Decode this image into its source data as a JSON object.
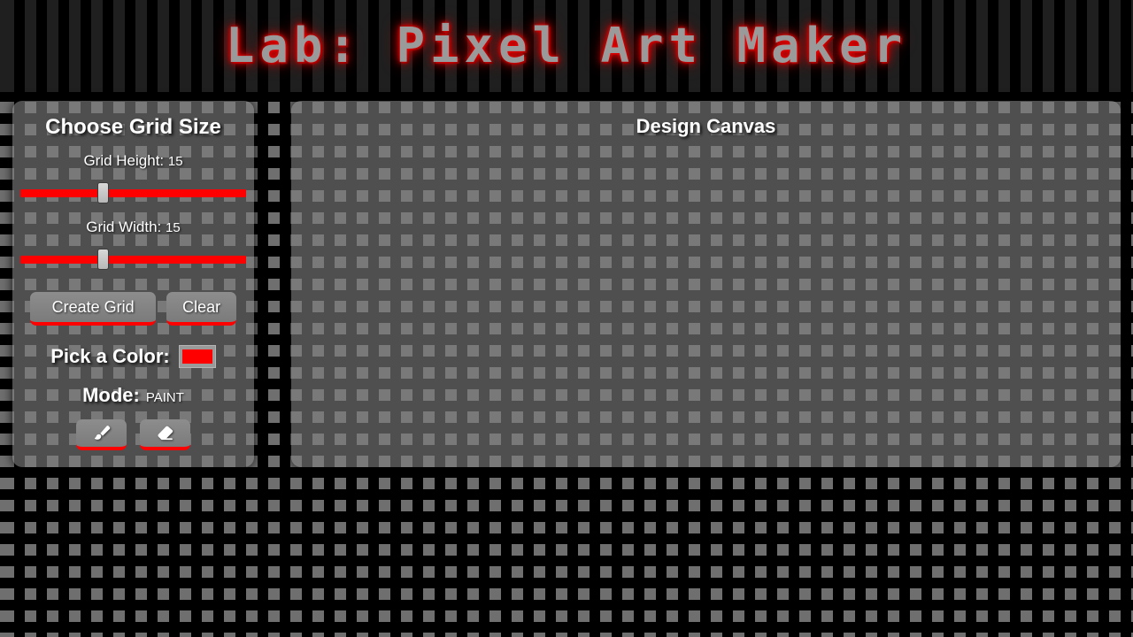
{
  "header": {
    "title": "Lab: Pixel Art Maker"
  },
  "sidebar": {
    "title": "Choose Grid Size",
    "height_slider": {
      "label": "Grid Height:",
      "value": "15",
      "min": 1,
      "max": 40,
      "current": 15
    },
    "width_slider": {
      "label": "Grid Width:",
      "value": "15",
      "min": 1,
      "max": 40,
      "current": 15
    },
    "create_grid_label": "Create Grid",
    "clear_label": "Clear",
    "color_label": "Pick a Color:",
    "color_value": "#ff0000",
    "mode_label": "Mode:",
    "mode_value": "PAINT",
    "tools": [
      {
        "name": "brush-tool",
        "icon": "paintbrush-icon"
      },
      {
        "name": "eraser-tool",
        "icon": "eraser-icon"
      }
    ]
  },
  "canvas": {
    "title": "Design Canvas"
  },
  "colors": {
    "accent": "#ff0000",
    "panel": "#808080",
    "background": "#000000",
    "text": "#ffffff",
    "title_text": "#9a9a9a"
  }
}
